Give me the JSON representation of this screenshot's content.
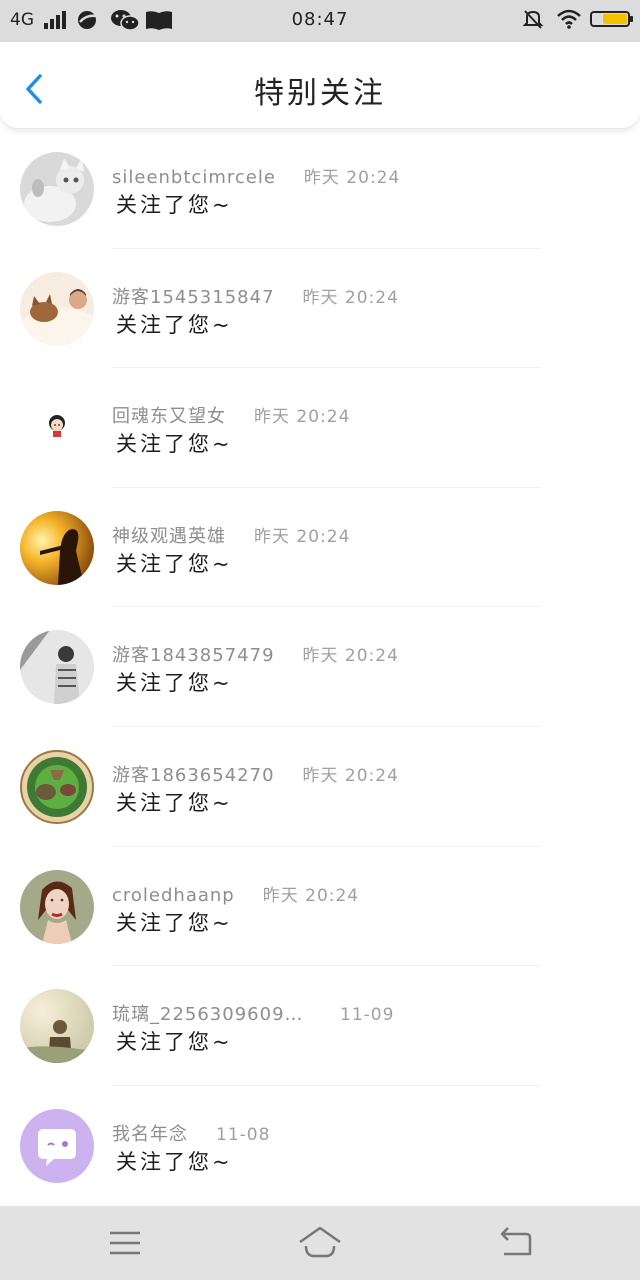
{
  "status_bar": {
    "network": "4G",
    "time": "08:47",
    "battery_level": 0.7,
    "battery_color": "#f3c100"
  },
  "header": {
    "title": "特别关注",
    "back_icon": "chevron-left-icon",
    "back_color": "#1e90e6"
  },
  "items": [
    {
      "name": "sileenbtcimrcele",
      "time": "昨天 20:24",
      "message": "关注了您~",
      "avatar": "cat"
    },
    {
      "name": "游客1545315847",
      "time": "昨天 20:24",
      "message": "关注了您~",
      "avatar": "sleeping-cat"
    },
    {
      "name": "回魂东又望女",
      "time": "昨天 20:24",
      "message": "关注了您~",
      "avatar": "small-girl"
    },
    {
      "name": "神级观遇英雄",
      "time": "昨天 20:24",
      "message": "关注了您~",
      "avatar": "sunset-silhouette"
    },
    {
      "name": "游客1843857479",
      "time": "昨天 20:24",
      "message": "关注了您~",
      "avatar": "bw-person"
    },
    {
      "name": "游客1863654270",
      "time": "昨天 20:24",
      "message": "关注了您~",
      "avatar": "game-badge"
    },
    {
      "name": "croledhaanp",
      "time": "昨天 20:24",
      "message": "关注了您~",
      "avatar": "woman-portrait"
    },
    {
      "name": "琉璃_22563096093…",
      "time": "11-09",
      "message": "关注了您~",
      "avatar": "soft-photo"
    },
    {
      "name": "我名年念",
      "time": "11-08",
      "message": "关注了您~",
      "avatar": "chat-bubble"
    }
  ],
  "nav": {
    "menu_icon": "menu-icon",
    "home_icon": "home-icon",
    "back_icon": "back-arrow-icon"
  }
}
